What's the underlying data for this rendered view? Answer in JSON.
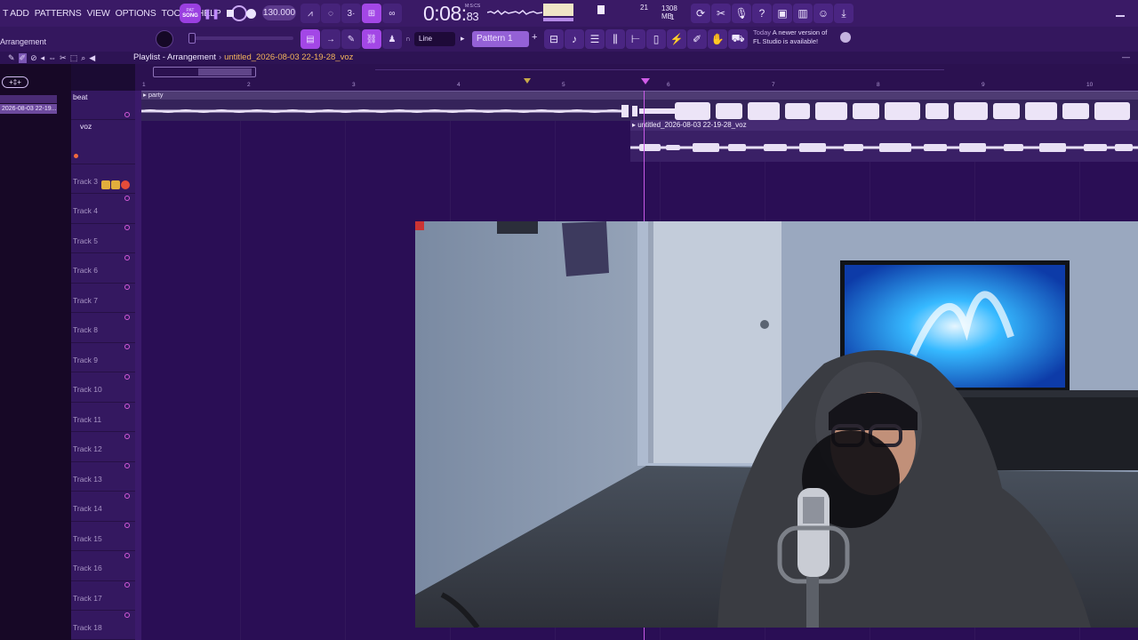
{
  "menu": {
    "items": [
      "T ADD",
      "PATTERNS",
      "VIEW",
      "OPTIONS",
      "TOOLS",
      "HELP"
    ]
  },
  "transport": {
    "song_pat_top": "PAT",
    "song_pat_bottom": "SONG",
    "tempo": "130.000",
    "time_main": "0:08",
    "time_ms": "83",
    "time_label": "M:S:CS"
  },
  "status": {
    "polyphony": "21",
    "memory": "1308 MB",
    "cores": "1"
  },
  "row2": {
    "arrangement": "Arrangement",
    "line_mode": "Line",
    "pattern": "Pattern 1"
  },
  "news": {
    "today": "Today",
    "message_1": "A newer version of",
    "message_2": "FL Studio is available!"
  },
  "playlist": {
    "title": "Playlist - Arrangement",
    "project": "untitled_2026-08-03 22-19-28_voz",
    "bar_numbers": [
      "1",
      "2",
      "3",
      "4",
      "5",
      "6",
      "7",
      "8",
      "9",
      "10"
    ],
    "clip_chip": "2026-08-03 22-19..."
  },
  "tracks": [
    {
      "name": "beat"
    },
    {
      "name": "voz"
    },
    {
      "name": "Track 3"
    },
    {
      "name": "Track 4"
    },
    {
      "name": "Track 5"
    },
    {
      "name": "Track 6"
    },
    {
      "name": "Track 7"
    },
    {
      "name": "Track 8"
    },
    {
      "name": "Track 9"
    },
    {
      "name": "Track 10"
    },
    {
      "name": "Track 11"
    },
    {
      "name": "Track 12"
    },
    {
      "name": "Track 13"
    },
    {
      "name": "Track 14"
    },
    {
      "name": "Track 15"
    },
    {
      "name": "Track 16"
    },
    {
      "name": "Track 17"
    },
    {
      "name": "Track 18"
    }
  ],
  "clips": {
    "beat_clip": "party",
    "voz_clip": "untitled_2026-08-03 22-19-28_voz"
  },
  "colors": {
    "accent": "#9a3fe0",
    "playhead": "#c85be6",
    "project_name": "#f3b45c"
  }
}
